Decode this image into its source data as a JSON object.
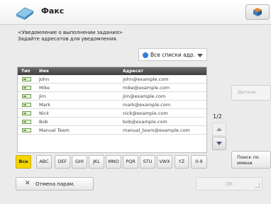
{
  "header": {
    "title": "Факс"
  },
  "instructions": {
    "line1": "<Уведомление о выполнении задания>",
    "line2": "Задайте адресатов для уведомления."
  },
  "address_list": {
    "selected": "Все списки адр."
  },
  "table": {
    "columns": {
      "type": "Тип",
      "name": "Имя",
      "address": "Адресат"
    },
    "rows": [
      {
        "name": "John",
        "email": "john@example.com"
      },
      {
        "name": "Mike",
        "email": "mike@example.com"
      },
      {
        "name": "Jim",
        "email": "jim@example.com"
      },
      {
        "name": "Mark",
        "email": "mark@example.com"
      },
      {
        "name": "Nick",
        "email": "nick@example.com"
      },
      {
        "name": "Bob",
        "email": "bob@example.com"
      },
      {
        "name": "Manual Team",
        "email": "manual_team@example.com"
      }
    ]
  },
  "side": {
    "details_label": "Детали",
    "page_indicator": "1/2",
    "search_line1": "Поиск по",
    "search_line2": "имени"
  },
  "alphabet": [
    "Все",
    "ABC",
    "DEF",
    "GHI",
    "JKL",
    "MNO",
    "PQR",
    "STU",
    "VWX",
    "YZ",
    "0-9"
  ],
  "footer": {
    "cancel_label": "Отмена парам.",
    "ok_label": "OK"
  },
  "colors": {
    "active_filter": "#f6d600",
    "header_bar": "#4a4a4a"
  }
}
